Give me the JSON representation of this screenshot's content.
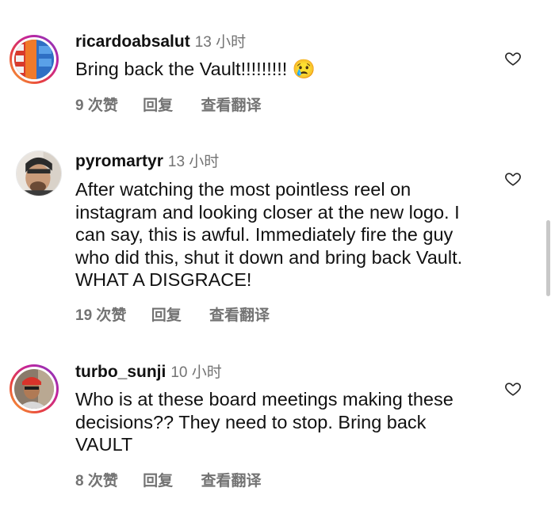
{
  "comments": [
    {
      "username": "ricardoabsalut",
      "time": "13 小时",
      "text": "Bring back the Vault!!!!!!!!! 😢",
      "likes": "9 次赞",
      "reply": "回复",
      "translate": "查看翻译"
    },
    {
      "username": "pyromartyr",
      "time": "13 小时",
      "text": "After watching the most pointless reel on instagram and looking closer at the new logo. I can say, this is awful. Immediately fire the guy who did this, shut it down and bring back Vault. WHAT A DISGRACE!",
      "likes": "19 次赞",
      "reply": "回复",
      "translate": "查看翻译"
    },
    {
      "username": "turbo_sunji",
      "time": "10 小时",
      "text": "Who is at these board meetings making these decisions?? They need to stop. Bring back VAULT",
      "likes": "8 次赞",
      "reply": "回复",
      "translate": "查看翻译"
    }
  ],
  "icons": {
    "like": "heart-outline-icon"
  }
}
